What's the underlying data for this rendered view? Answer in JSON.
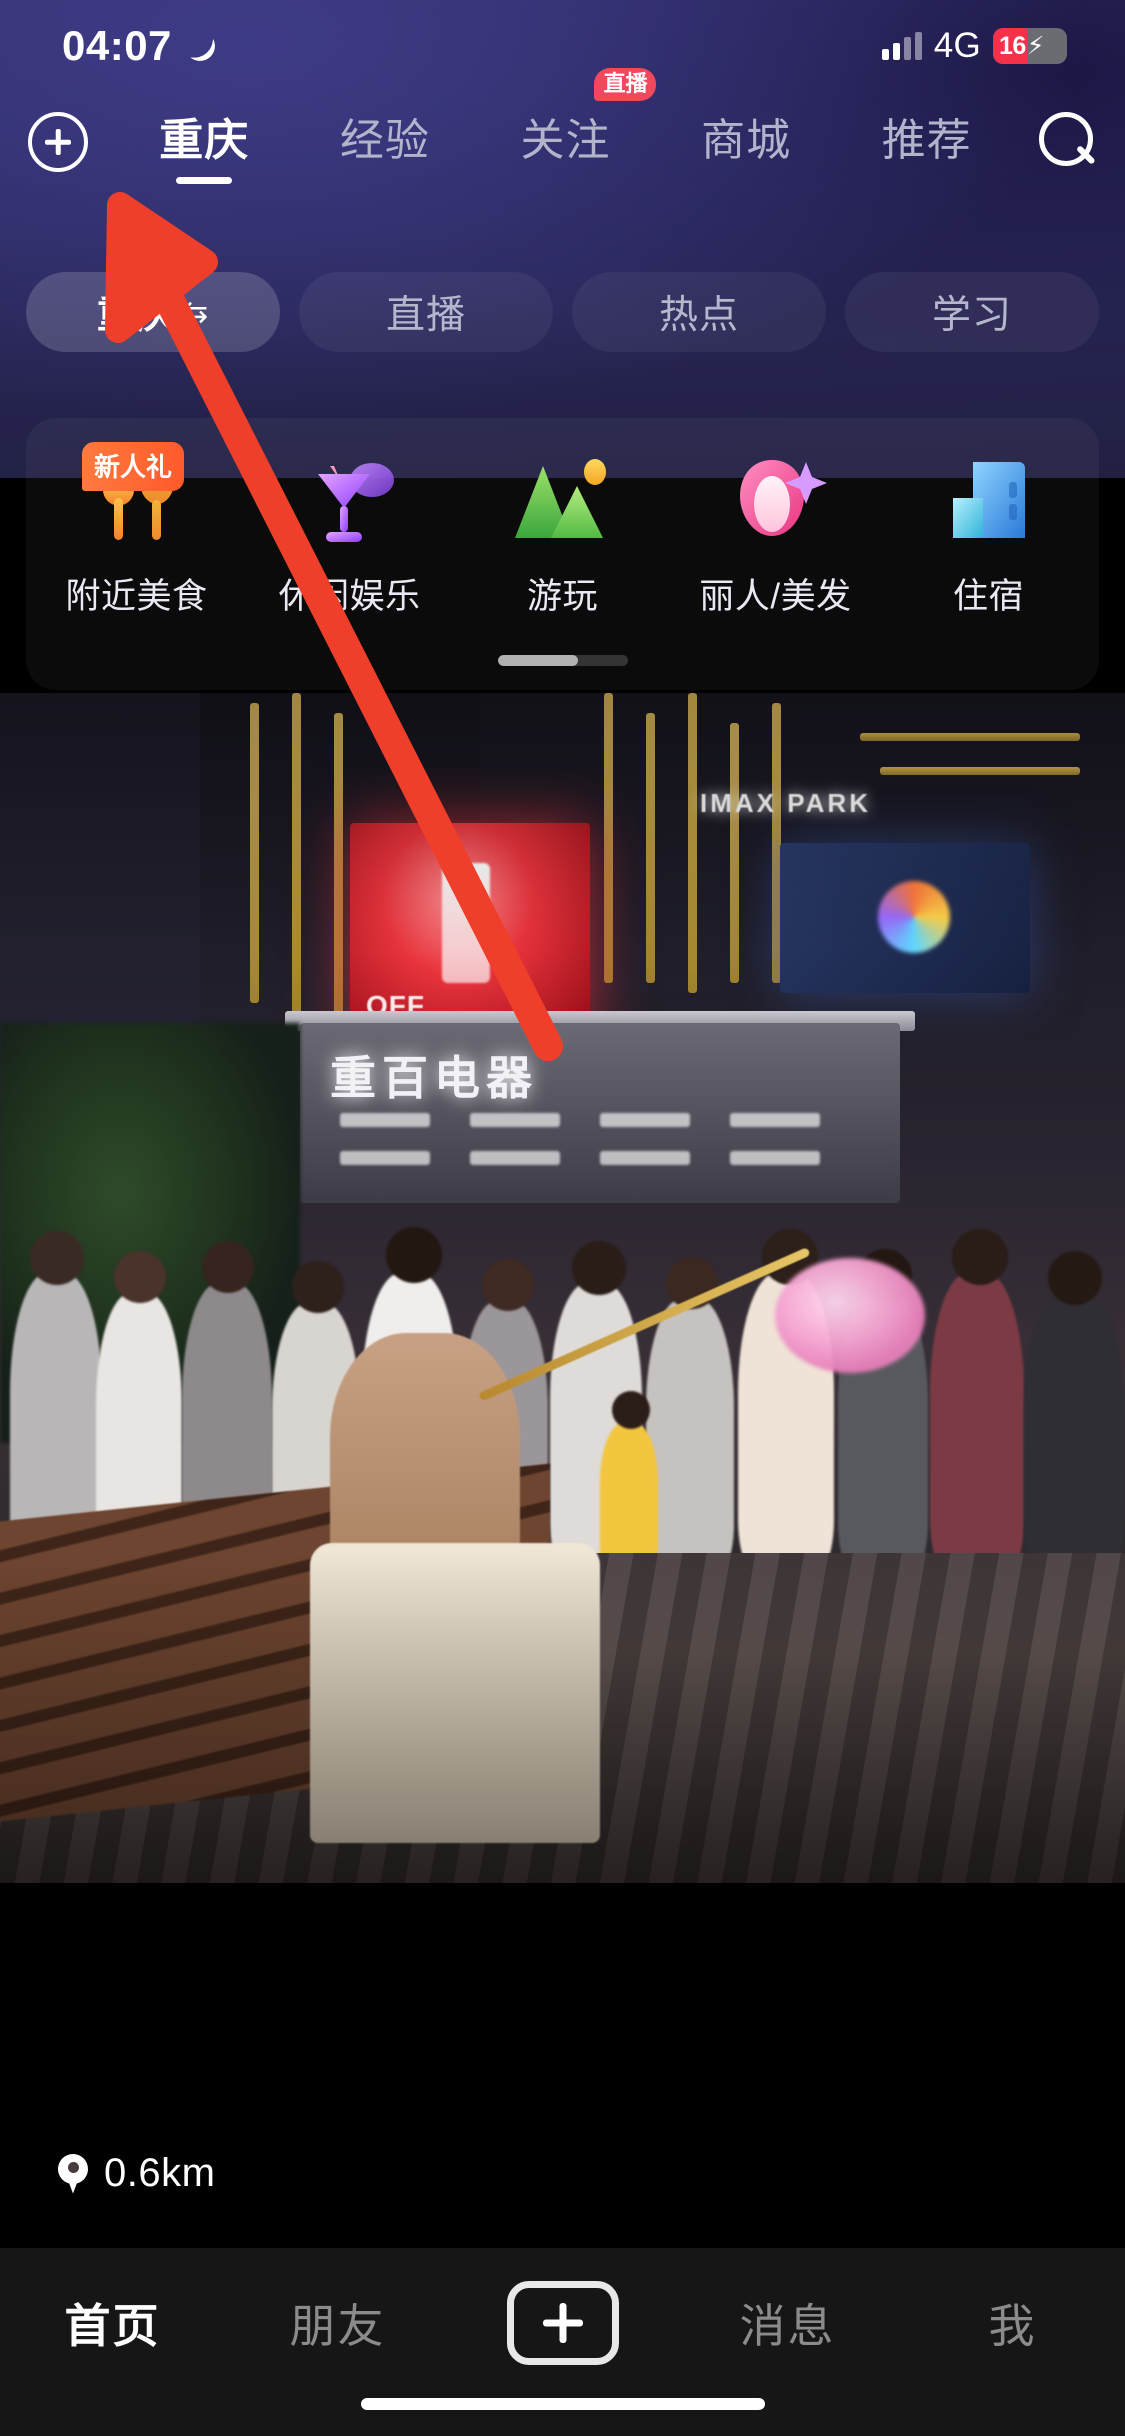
{
  "status_bar": {
    "time": "04:07",
    "moon_icon": "moon-icon",
    "network": "4G",
    "battery_level": "16",
    "battery_bolt": "⚡",
    "signal_icon": "signal-bars-icon"
  },
  "top_nav": {
    "add_icon": "plus-circle-icon",
    "search_icon": "search-icon",
    "tabs": [
      {
        "label": "重庆",
        "active": true,
        "badge": ""
      },
      {
        "label": "经验",
        "active": false,
        "badge": ""
      },
      {
        "label": "关注",
        "active": false,
        "badge": "直播"
      },
      {
        "label": "商城",
        "active": false,
        "badge": ""
      },
      {
        "label": "推荐",
        "active": false,
        "badge": ""
      }
    ]
  },
  "filter_chips": [
    {
      "label": "重庆",
      "swap": "⇆",
      "active": true
    },
    {
      "label": "直播",
      "swap": "",
      "active": false
    },
    {
      "label": "热点",
      "swap": "",
      "active": false
    },
    {
      "label": "学习",
      "swap": "",
      "active": false
    }
  ],
  "categories": {
    "items": [
      {
        "label": "附近美食",
        "icon": "cutlery-icon",
        "badge": "新人礼"
      },
      {
        "label": "休闲娱乐",
        "icon": "cocktail-icon",
        "badge": ""
      },
      {
        "label": "游玩",
        "icon": "mountain-icon",
        "badge": ""
      },
      {
        "label": "丽人/美发",
        "icon": "beauty-icon",
        "badge": ""
      },
      {
        "label": "住宿",
        "icon": "hotel-icon",
        "badge": ""
      }
    ],
    "scroll_indicator": "carousel-scroll-indicator"
  },
  "feed": {
    "distance": "0.6km",
    "pin_icon": "location-pin-icon",
    "scene_text": {
      "mall_sign": "重百电器",
      "imax": "IMAX PARK",
      "ad_text": "OFF"
    }
  },
  "bottom_nav": {
    "tabs": [
      {
        "label": "首页",
        "active": true
      },
      {
        "label": "朋友",
        "active": false
      },
      {
        "label": "消息",
        "active": false
      },
      {
        "label": "我",
        "active": false
      }
    ],
    "create_icon": "plus-box-icon"
  },
  "annotation": {
    "arrow_color": "#ef3f2a",
    "target": "重庆 filter chip"
  }
}
